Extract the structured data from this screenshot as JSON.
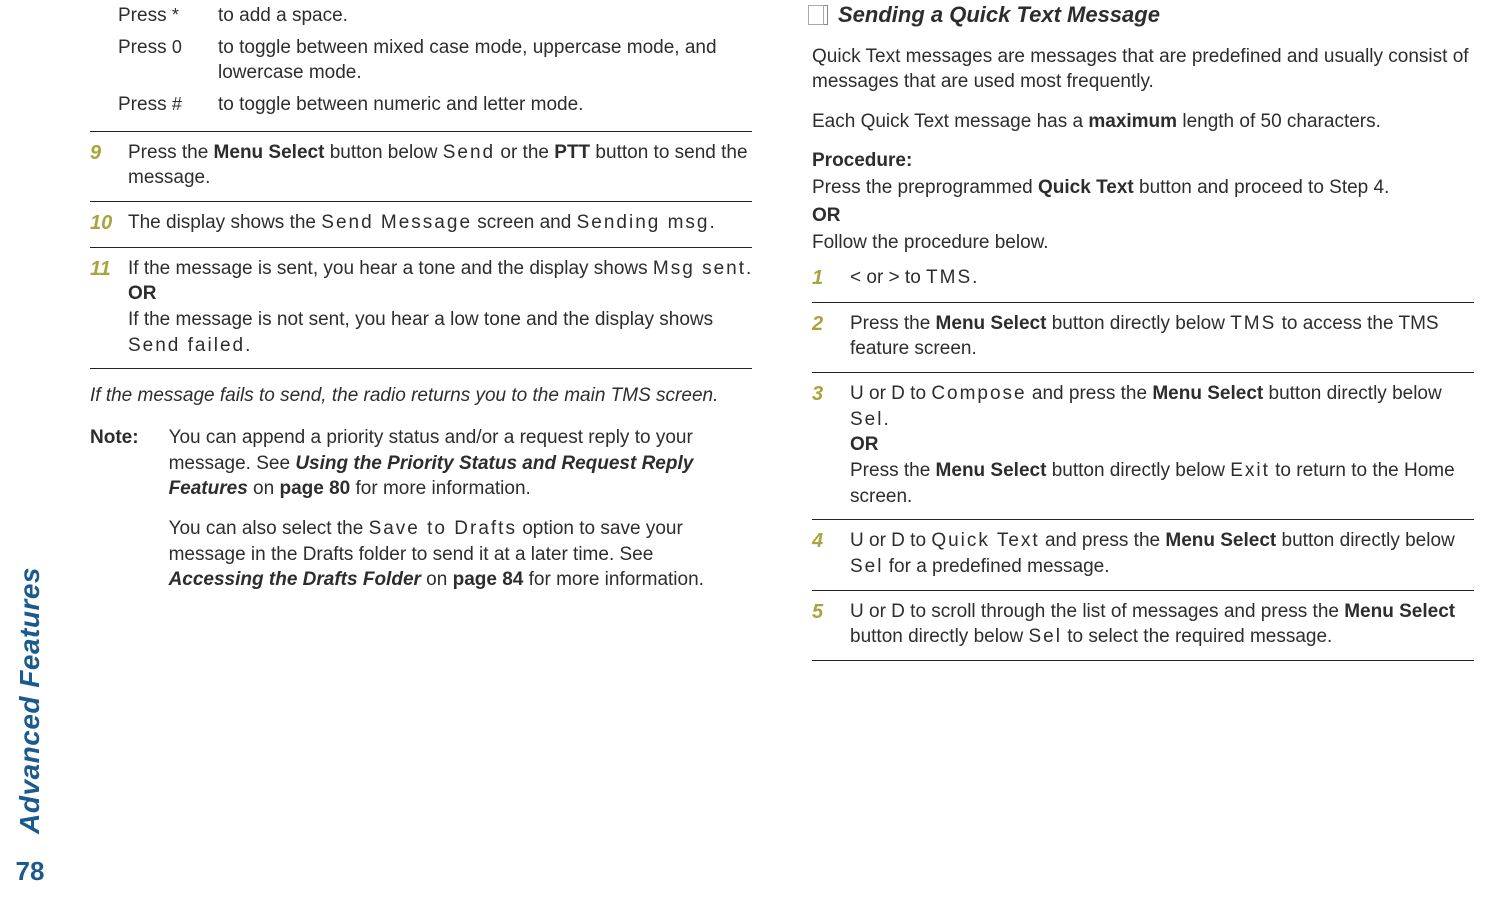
{
  "side": {
    "label": "Advanced Features",
    "page": "78"
  },
  "left": {
    "keygrid": [
      {
        "p": "Press ",
        "k": "*",
        "d": "to add a space."
      },
      {
        "p": "Press ",
        "k": "0",
        "d": "to toggle between mixed case mode, uppercase mode, and lowercase mode."
      },
      {
        "p": "Press ",
        "k": "#",
        "d": "to toggle between numeric and letter mode."
      }
    ],
    "steps": {
      "s9_num": "9",
      "s9_a": "Press the ",
      "s9_b": "Menu Select",
      "s9_c": " button below ",
      "s9_d": "Send",
      "s9_e": " or the ",
      "s9_f": "PTT",
      "s9_g": " button to send the message.",
      "s10_num": "10",
      "s10_a": "The display shows the ",
      "s10_b": "Send Message",
      "s10_c": " screen and ",
      "s10_d": "Sending msg",
      "s10_e": ".",
      "s11_num": "11",
      "s11_a": "If the message is sent, you hear a tone and the display shows ",
      "s11_b": "Msg sent",
      "s11_c": ".",
      "s11_or": "OR",
      "s11_d": "If the message is not sent, you hear a low tone and the display shows ",
      "s11_e": "Send failed",
      "s11_f": "."
    },
    "fail": "If the message fails to send, the radio returns you to the main TMS screen.",
    "note_label": "Note:",
    "note1_a": "You can append a priority status and/or a request reply to your message. See ",
    "note1_b": "Using the Priority Status and Request Reply Features",
    "note1_c": " on ",
    "note1_d": "page 80",
    "note1_e": " for more information.",
    "note2_a": "You can also select the ",
    "note2_b": "Save to Drafts",
    "note2_c": " option to save your message in the Drafts folder to send it at a later time. See ",
    "note2_d": "Accessing the Drafts Folder",
    "note2_e": " on ",
    "note2_f": "page 84",
    "note2_g": " for more information."
  },
  "right": {
    "heading": "Sending a Quick Text Message",
    "p1": "Quick Text messages are messages that are predefined and usually consist of messages that are used most frequently.",
    "p2_a": "Each Quick Text message has a ",
    "p2_b": "maximum",
    "p2_c": " length of 50 characters.",
    "proc_label": "Procedure:",
    "proc_a": "Press the preprogrammed ",
    "proc_b": "Quick Text",
    "proc_c": " button and proceed to Step 4.",
    "proc_or": "OR",
    "proc_follow": "Follow the procedure below.",
    "steps": {
      "s1_num": "1",
      "s1_a": "< or > to ",
      "s1_b": "TMS",
      "s1_c": ".",
      "s2_num": "2",
      "s2_a": "Press the ",
      "s2_b": "Menu Select",
      "s2_c": " button directly below ",
      "s2_d": "TMS",
      "s2_e": " to access the TMS feature screen.",
      "s3_num": "3",
      "s3_a": "U or D to ",
      "s3_b": "Compose",
      "s3_c": " and press the ",
      "s3_d": "Menu Select",
      "s3_e": " button directly below ",
      "s3_f": "Sel",
      "s3_g": ".",
      "s3_or": "OR",
      "s3_h": "Press the ",
      "s3_i": "Menu Select",
      "s3_j": " button directly below ",
      "s3_k": "Exit",
      "s3_l": " to return to the Home screen.",
      "s4_num": "4",
      "s4_a": "U or D to ",
      "s4_b": "Quick Text",
      "s4_c": " and press the ",
      "s4_d": "Menu Select",
      "s4_e": " button directly below ",
      "s4_f": "Sel",
      "s4_g": " for a predefined message.",
      "s5_num": "5",
      "s5_a": "U or D to scroll through the list of messages and press the ",
      "s5_b": "Menu Select",
      "s5_c": " button directly below ",
      "s5_d": "Sel",
      "s5_e": " to select the required message."
    }
  }
}
